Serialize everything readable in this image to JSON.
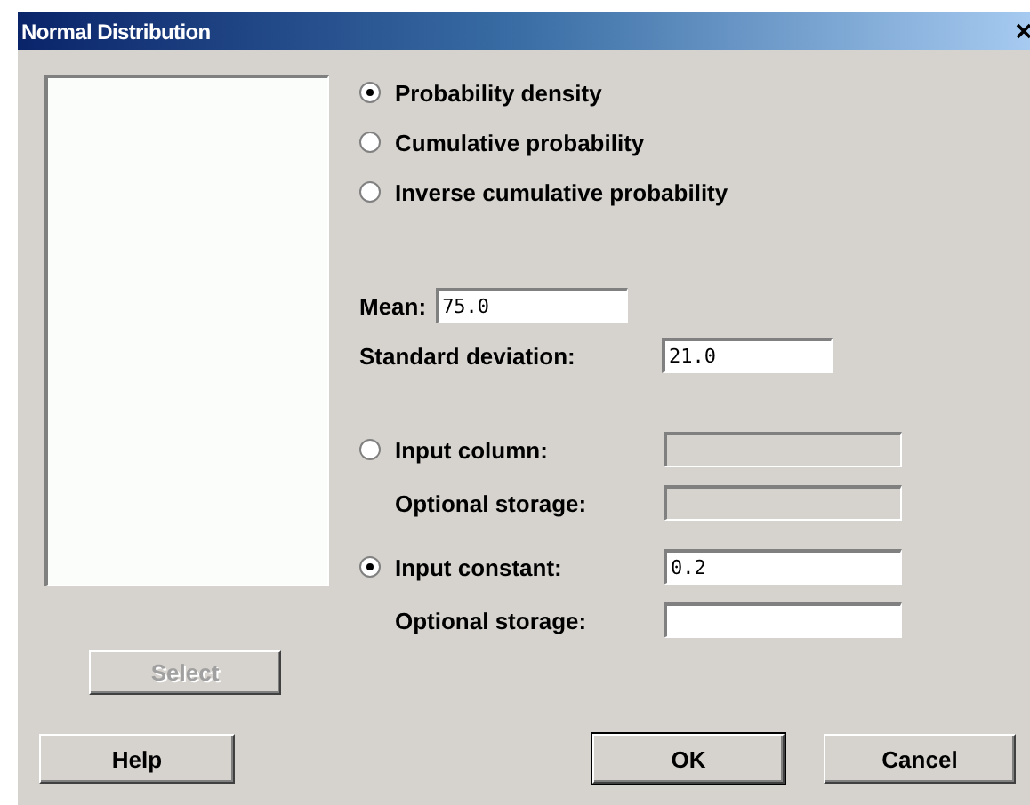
{
  "window": {
    "title": "Normal Distribution"
  },
  "distribution_options": [
    {
      "label": "Probability density",
      "selected": true
    },
    {
      "label": "Cumulative probability",
      "selected": false
    },
    {
      "label": "Inverse cumulative probability",
      "selected": false
    }
  ],
  "mean": {
    "label": "Mean:",
    "value": "75.0"
  },
  "standard_deviation": {
    "label": "Standard deviation:",
    "value": "21.0"
  },
  "input_options": [
    {
      "label": "Input column:",
      "selected": false,
      "storage_label": "Optional storage:",
      "disabled": true
    },
    {
      "label": "Input constant:",
      "selected": true,
      "value": "0.2",
      "storage_label": "Optional storage:",
      "disabled": false
    }
  ],
  "select_button": {
    "label": "Select",
    "disabled": true
  },
  "buttons": [
    {
      "label": "Help",
      "default": false
    },
    {
      "label": "OK",
      "default": true
    },
    {
      "label": "Cancel",
      "default": false
    }
  ]
}
